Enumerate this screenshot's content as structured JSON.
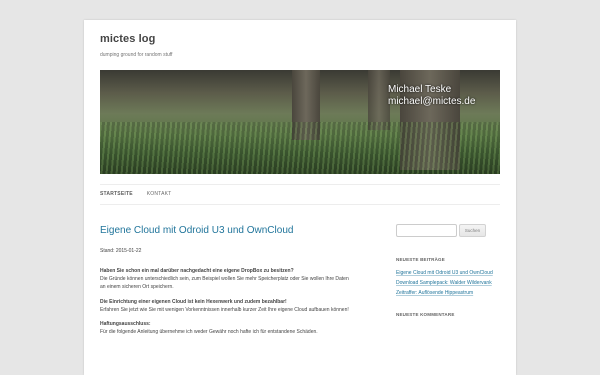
{
  "site": {
    "title": "mictes log",
    "description": "dumping ground for random stuff"
  },
  "header_image": {
    "overlay_name": "Michael Teske",
    "overlay_email": "michael@mictes.de"
  },
  "nav": {
    "items": [
      {
        "label": "STARTSEITE",
        "current": true
      },
      {
        "label": "KONTAKT",
        "current": false
      }
    ]
  },
  "post": {
    "title": "Eigene Cloud mit Odroid U3 und OwnCloud",
    "date": "Stand: 2015-01-22",
    "paragraphs": [
      {
        "heading": "Haben Sie schon ein mal darüber nachgedacht eine eigene DropBox zu besitzen?",
        "text": "Die Gründe können unterschiedlich sein, zum Beispiel wollen Sie mehr Speicherplatz oder Sie wollen Ihre Daten an einem sicheren Ort speichern."
      },
      {
        "heading": "Die Einrichtung einer eigenen Cloud ist kein Hexenwerk und zudem bezahlbar!",
        "text": "Erfahren Sie jetzt wie Sie mit wenigen Vorkenntnissen innerhalb kurzer Zeit Ihre eigene Cloud aufbauen können!"
      },
      {
        "heading": "Haftungsausschluss:",
        "text": "Für die folgende Anleitung übernehme ich weder Gewähr noch hafte ich für entstandene Schäden."
      }
    ]
  },
  "sidebar": {
    "search_placeholder": "",
    "search_button": "Suchen",
    "recent_posts_title": "NEUESTE BEITRÄGE",
    "recent_posts": [
      "Eigene Cloud mit Odroid U3 und OwnCloud",
      "Download Samplepack: Walder Wildervank",
      "Zeitraffer: Auflösende Hippeastrum"
    ],
    "recent_comments_title": "NEUESTE KOMMENTARE"
  }
}
